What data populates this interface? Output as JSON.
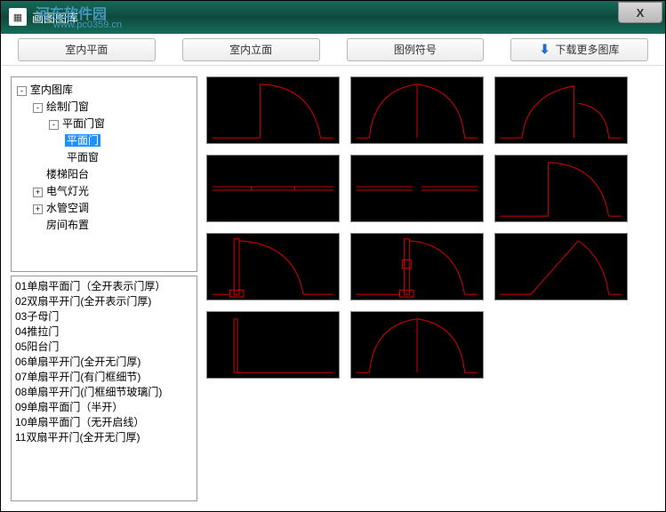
{
  "window": {
    "title": "画图图库",
    "close": "X"
  },
  "watermark": {
    "main": "河东软件园",
    "sub": "www.pc0359.cn"
  },
  "tabs": {
    "t1": "室内平面",
    "t2": "室内立面",
    "t3": "图例符号",
    "t4": "下载更多图库"
  },
  "tree": {
    "n0": "室内图库",
    "n1": "绘制门窗",
    "n2": "平面门窗",
    "n3": "平面门",
    "n4": "平面窗",
    "n5": "楼梯阳台",
    "n6": "电气灯光",
    "n7": "水管空调",
    "n8": "房间布置"
  },
  "list": {
    "i1": "01单扇平面门（全开表示门厚）",
    "i2": "02双扇平开门(全开表示门厚)",
    "i3": "03子母门",
    "i4": "04推拉门",
    "i5": "05阳台门",
    "i6": "06单扇平开门(全开无门厚)",
    "i7": "07单扇平开门(有门框细节)",
    "i8": "08单扇平开门(门框细节玻璃门)",
    "i9": "09单扇平面门（半开）",
    "i10": "10单扇平面门（无开启线）",
    "i11": "11双扇平开门(全开无门厚)"
  }
}
